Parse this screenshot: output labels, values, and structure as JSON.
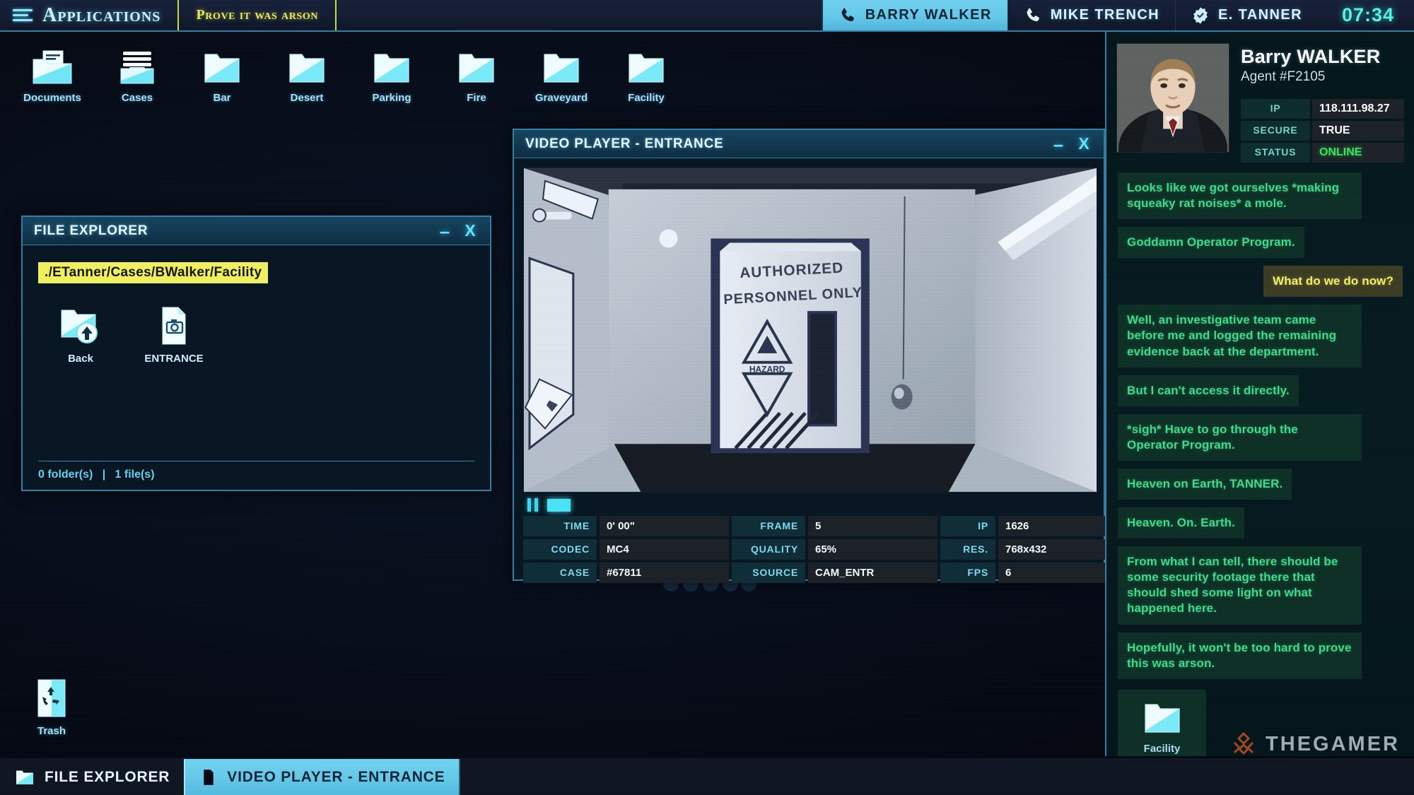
{
  "topbar": {
    "apps_label": "Applications",
    "menu_icon": "hamburger-menu-icon",
    "objective": "Prove it was arson",
    "clock": "07:34",
    "contacts": [
      {
        "name": "BARRY WALKER",
        "icon": "phone-icon",
        "active": true
      },
      {
        "name": "MIKE TRENCH",
        "icon": "phone-icon",
        "active": false
      },
      {
        "name": "E. TANNER",
        "icon": "verified-badge-icon",
        "active": false
      }
    ]
  },
  "desktop": {
    "icons": [
      {
        "label": "Documents",
        "icon": "documents-folder-icon"
      },
      {
        "label": "Cases",
        "icon": "case-files-icon"
      },
      {
        "label": "Bar",
        "icon": "folder-icon"
      },
      {
        "label": "Desert",
        "icon": "folder-icon"
      },
      {
        "label": "Parking",
        "icon": "folder-icon"
      },
      {
        "label": "Fire",
        "icon": "folder-icon"
      },
      {
        "label": "Graveyard",
        "icon": "folder-icon"
      },
      {
        "label": "Facility",
        "icon": "folder-icon"
      }
    ],
    "trash": {
      "label": "Trash",
      "icon": "recycle-bin-icon"
    }
  },
  "file_explorer": {
    "title": "FILE EXPLORER",
    "minimize_label": "–",
    "close_label": "X",
    "path": "./ETanner/Cases/BWalker/Facility",
    "items": [
      {
        "label": "Back",
        "icon": "folder-up-icon",
        "type": "navigation"
      },
      {
        "label": "ENTRANCE",
        "icon": "camera-file-icon",
        "type": "file"
      }
    ],
    "status_folders": "0 folder(s)",
    "status_separator": "|",
    "status_files": "1 file(s)"
  },
  "video_player": {
    "title": "VIDEO PLAYER - ENTRANCE",
    "minimize_label": "–",
    "close_label": "X",
    "pause_icon": "pause-icon",
    "stop_icon": "stop-icon",
    "footage_caption_line1": "AUTHORIZED",
    "footage_caption_line2": "PERSONNEL ONLY",
    "meta": [
      [
        {
          "key": "TIME",
          "value": "0' 00\""
        },
        {
          "key": "FRAME",
          "value": "5"
        },
        {
          "key": "IP",
          "value": "1626"
        }
      ],
      [
        {
          "key": "CODEC",
          "value": "MC4"
        },
        {
          "key": "QUALITY",
          "value": "65%"
        },
        {
          "key": "RES.",
          "value": "768x432"
        }
      ],
      [
        {
          "key": "CASE",
          "value": "#67811"
        },
        {
          "key": "SOURCE",
          "value": "CAM_ENTR"
        },
        {
          "key": "FPS",
          "value": "6"
        }
      ]
    ]
  },
  "sidebar": {
    "avatar_icon": "agent-portrait",
    "agent_name": "Barry WALKER",
    "agent_id": "Agent #F2105",
    "details": [
      {
        "key": "IP",
        "value": "118.111.98.27",
        "state": "normal"
      },
      {
        "key": "SECURE",
        "value": "TRUE",
        "state": "normal"
      },
      {
        "key": "STATUS",
        "value": "ONLINE",
        "state": "online"
      }
    ],
    "messages": [
      {
        "from": "them",
        "text": "Looks like we got ourselves *making squeaky rat noises* a mole."
      },
      {
        "from": "them",
        "text": "Goddamn Operator Program."
      },
      {
        "from": "me",
        "text": "What do we do now?"
      },
      {
        "from": "them",
        "text": "Well, an investigative team came before me and logged the remaining evidence back at the department."
      },
      {
        "from": "them",
        "text": "But I can't access it directly."
      },
      {
        "from": "them",
        "text": "*sigh* Have to go through the Operator Program."
      },
      {
        "from": "them",
        "text": "Heaven on Earth, TANNER."
      },
      {
        "from": "them",
        "text": "Heaven. On. Earth."
      },
      {
        "from": "them",
        "text": "From what I can tell, there should be some security footage there that should shed some light on what happened here."
      },
      {
        "from": "them",
        "text": "Hopefully, it won't be too hard to prove this was arson."
      }
    ],
    "attachment": {
      "label": "Facility",
      "icon": "folder-icon"
    }
  },
  "taskbar": {
    "items": [
      {
        "label": "FILE EXPLORER",
        "icon": "folder-icon",
        "active": false
      },
      {
        "label": "VIDEO PLAYER - ENTRANCE",
        "icon": "camera-file-icon",
        "active": true
      }
    ]
  },
  "watermark": {
    "text": "THEGAMER",
    "icon": "thegamer-logo-icon"
  },
  "colors": {
    "accent_cyan": "#4fb6dc",
    "accent_yellow": "#e9ea5b",
    "chat_them": "#3fd98a",
    "chat_me": "#f0ee68",
    "status_online": "#39e35a",
    "window_border": "#2d7fa6",
    "clock": "#53f2e6"
  }
}
